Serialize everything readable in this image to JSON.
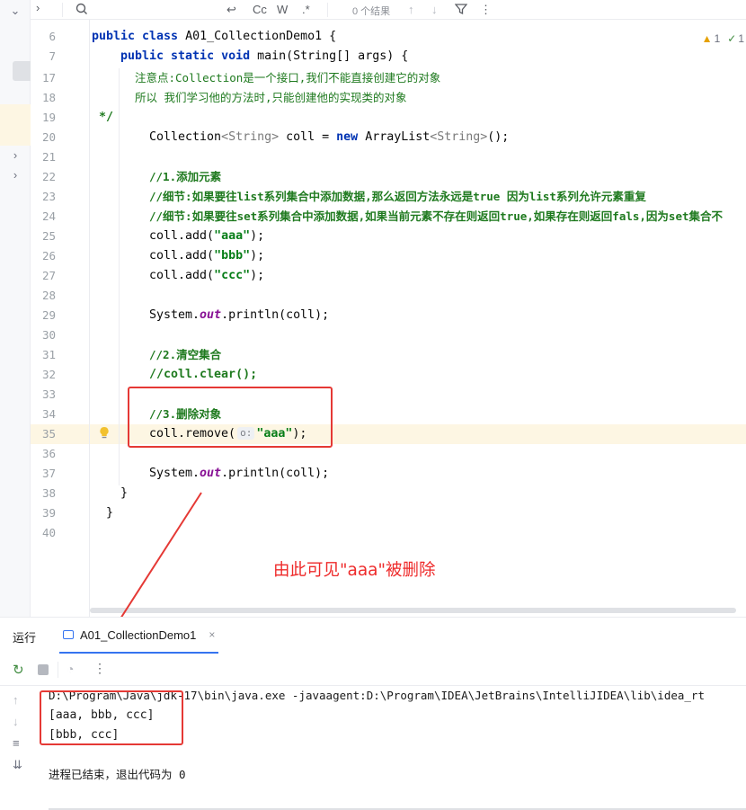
{
  "find_bar": {
    "match_case": "Cc",
    "whole_word": "W",
    "regex": ".*",
    "results": "0 个结果"
  },
  "editor": {
    "lines": [
      {
        "num": "6",
        "y": 0
      },
      {
        "num": "7",
        "y": 0
      },
      {
        "num": "17",
        "y": 0
      },
      {
        "num": "18",
        "y": 0
      },
      {
        "num": "19",
        "y": 0
      },
      {
        "num": "20",
        "y": 0
      },
      {
        "num": "21",
        "y": 0
      },
      {
        "num": "22",
        "y": 0
      },
      {
        "num": "23",
        "y": 0
      },
      {
        "num": "24",
        "y": 0
      },
      {
        "num": "25",
        "y": 0
      },
      {
        "num": "26",
        "y": 0
      },
      {
        "num": "27",
        "y": 0
      },
      {
        "num": "28",
        "y": 0
      },
      {
        "num": "29",
        "y": 0
      },
      {
        "num": "30",
        "y": 0
      },
      {
        "num": "31",
        "y": 0
      },
      {
        "num": "32",
        "y": 0
      },
      {
        "num": "33",
        "y": 0
      },
      {
        "num": "34",
        "y": 0
      },
      {
        "num": "35",
        "y": 0
      },
      {
        "num": "36",
        "y": 0
      },
      {
        "num": "37",
        "y": 0
      },
      {
        "num": "38",
        "y": 0
      },
      {
        "num": "39",
        "y": 0
      },
      {
        "num": "40",
        "y": 0
      }
    ],
    "code": {
      "l6_kw": "public class ",
      "l6_rest": "A01_CollectionDemo1 {",
      "l7_kw": "public static void ",
      "l7_rest": "main(String[] args) {",
      "l17": "注意点:Collection是一个接口,我们不能直接创建它的对象",
      "l18": "所以 我们学习他的方法时,只能创建他的实现类的对象",
      "l19": "*/",
      "l20_a": "Collection",
      "l20_b": "<String>",
      "l20_c": " coll = ",
      "l20_new": "new ",
      "l20_d": "ArrayList",
      "l20_e": "<String>",
      "l20_f": "();",
      "l22": "//1.添加元素",
      "l23": "//细节:如果要往list系列集合中添加数据,那么返回方法永远是true 因为list系列允许元素重复",
      "l24": "//细节:如果要往set系列集合中添加数据,如果当前元素不存在则返回true,如果存在则返回fals,因为set集合不",
      "l25_a": "coll.add(",
      "l25_s": "\"aaa\"",
      "l25_b": ");",
      "l26_a": "coll.add(",
      "l26_s": "\"bbb\"",
      "l26_b": ");",
      "l27_a": "coll.add(",
      "l27_s": "\"ccc\"",
      "l27_b": ");",
      "l29_a": "System.",
      "l29_it": "out",
      "l29_b": ".println(coll);",
      "l31": "//2.清空集合",
      "l32": "//coll.clear();",
      "l34": "//3.删除对象",
      "l35_a": "coll.remove(",
      "l35_hint": "o:",
      "l35_s": "\"aaa\"",
      "l35_b": ");",
      "l37_a": "System.",
      "l37_it": "out",
      "l37_b": ".println(coll);",
      "l38": "}",
      "l39": "}"
    },
    "warnings_count": "1",
    "checks_count": "1"
  },
  "annotation": "由此可见\"aaa\"被删除",
  "run_panel": {
    "title": "运行",
    "tab_label": "A01_CollectionDemo1",
    "console": [
      "D:\\Program\\Java\\jdk-17\\bin\\java.exe -javaagent:D:\\Program\\IDEA\\JetBrains\\IntelliJIDEA\\lib\\idea_rt",
      "[aaa, bbb, ccc]",
      "[bbb, ccc]",
      "",
      "进程已结束，退出代码为 0"
    ]
  },
  "colors": {
    "keyword": "#0033b3",
    "comment": "#1f7a1f",
    "string": "#067d17",
    "annotation_red": "#e53935",
    "accent": "#3574f0"
  }
}
